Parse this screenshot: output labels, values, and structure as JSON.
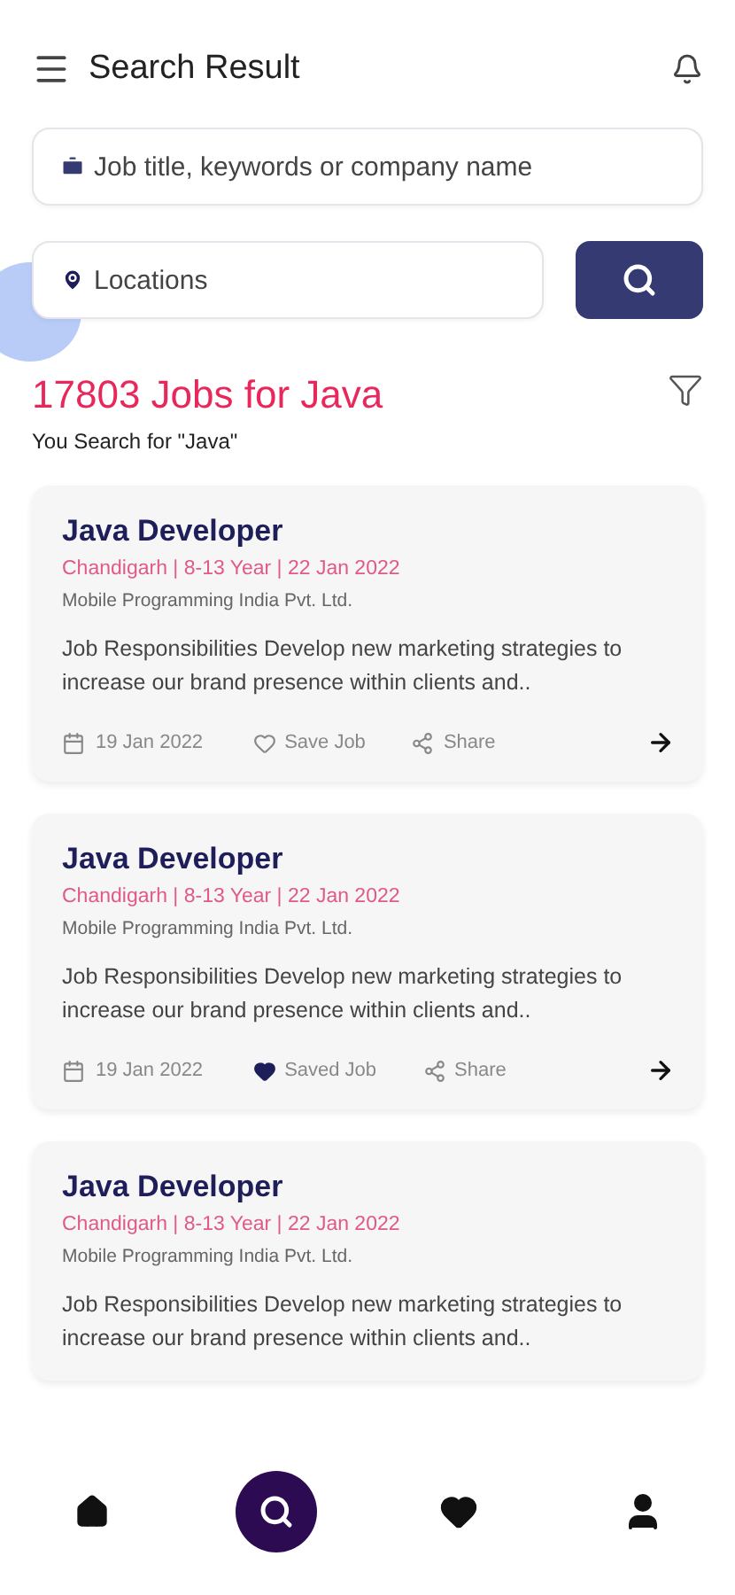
{
  "header": {
    "title": "Search Result"
  },
  "search": {
    "keyword_placeholder": "Job title, keywords or company name",
    "location_placeholder": "Locations"
  },
  "results": {
    "headline": "17803 Jobs for Java",
    "subtitle": "You Search for \"Java\""
  },
  "jobs": [
    {
      "title": "Java Developer",
      "meta": "Chandigarh | 8-13 Year | 22 Jan 2022",
      "company": "Mobile Programming India Pvt. Ltd.",
      "description": "Job Responsibilities Develop new marketing strategies to increase our brand presence within clients and..",
      "footer": {
        "date": "19 Jan 2022",
        "save_label": "Save Job",
        "saved": false,
        "share_label": "Share"
      }
    },
    {
      "title": "Java Developer",
      "meta": "Chandigarh | 8-13 Year | 22 Jan 2022",
      "company": "Mobile Programming India Pvt. Ltd.",
      "description": "Job Responsibilities Develop new marketing strategies to increase our brand presence within clients and..",
      "footer": {
        "date": "19 Jan 2022",
        "save_label": "Saved Job",
        "saved": true,
        "share_label": "Share"
      }
    },
    {
      "title": "Java Developer",
      "meta": "Chandigarh | 8-13 Year | 22 Jan 2022",
      "company": "Mobile Programming India Pvt. Ltd.",
      "description": "Job Responsibilities Develop new marketing strategies to increase our brand presence within clients and.."
    }
  ],
  "nav": [
    {
      "kind": "home",
      "selected": false
    },
    {
      "kind": "search",
      "selected": true
    },
    {
      "kind": "favorites",
      "selected": false
    },
    {
      "kind": "profile",
      "selected": false
    }
  ]
}
